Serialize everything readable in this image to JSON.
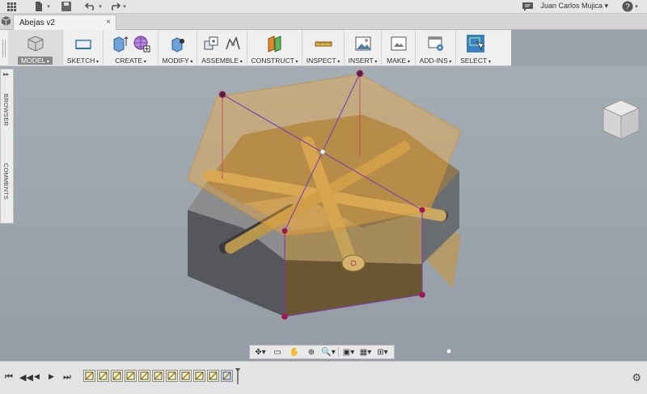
{
  "app": {
    "user_name": "Juan Carlos Mujica ▾",
    "help": "?"
  },
  "document": {
    "tab_title": "Abejas v2",
    "close": "×"
  },
  "ribbon": {
    "groups": [
      {
        "id": "model",
        "label": "MODEL"
      },
      {
        "id": "sketch",
        "label": "SKETCH"
      },
      {
        "id": "create",
        "label": "CREATE"
      },
      {
        "id": "modify",
        "label": "MODIFY"
      },
      {
        "id": "assemble",
        "label": "ASSEMBLE"
      },
      {
        "id": "construct",
        "label": "CONSTRUCT"
      },
      {
        "id": "inspect",
        "label": "INSPECT"
      },
      {
        "id": "insert",
        "label": "INSERT"
      },
      {
        "id": "make",
        "label": "MAKE"
      },
      {
        "id": "addins",
        "label": "ADD-INS"
      },
      {
        "id": "select",
        "label": "SELECT"
      }
    ]
  },
  "panel": {
    "browser": "BROWSER",
    "comments": "COMMENTS",
    "expand": "▸▸"
  },
  "icons": {
    "grid": "app-grid-icon",
    "file": "file-icon",
    "save": "save-icon",
    "undo": "undo-icon",
    "redo": "redo-icon",
    "messages": "messages-icon",
    "help": "help-icon",
    "gear": "gear-icon"
  },
  "colors": {
    "accent_purple": "#7b3fb0",
    "handle_magenta": "#a0155a",
    "model_body": "#8b7a5e",
    "plane_orange": "#e8a84a",
    "select_blue": "#3a7fc1"
  },
  "timeline": {
    "feature_count": 11
  }
}
